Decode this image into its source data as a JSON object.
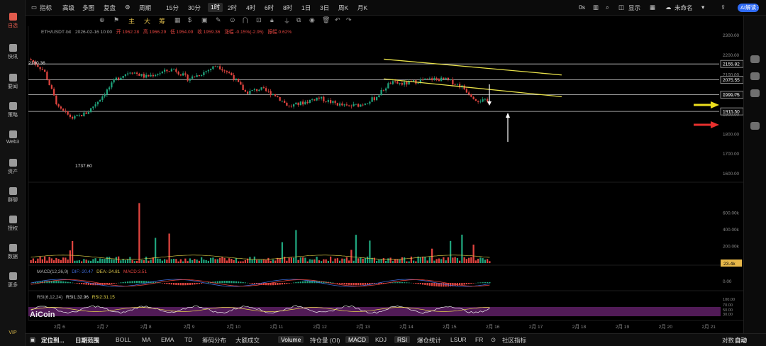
{
  "toolbar": {
    "indicators": "指标",
    "premium": "高级",
    "multi": "多图",
    "replay": "复盘",
    "period": "周期",
    "tf_15m": "15分",
    "tf_30m": "30分",
    "tf_1h": "1时",
    "tf_2h": "2时",
    "tf_4h": "4时",
    "tf_6h": "6时",
    "tf_8h": "8时",
    "tf_1d": "1日",
    "tf_3d": "3日",
    "tf_1w": "周K",
    "tf_1m": "月K",
    "seconds": "0s",
    "display": "显示",
    "unnamed": "未命名",
    "ai": "AI解读"
  },
  "drawbar": {
    "main": "主",
    "big": "大",
    "chips": "筹"
  },
  "rail": [
    {
      "label": "自选"
    },
    {
      "label": "快讯"
    },
    {
      "label": "要闻"
    },
    {
      "label": "策略"
    },
    {
      "label": "Web3"
    },
    {
      "label": "资产"
    },
    {
      "label": "群聊"
    },
    {
      "label": "授权"
    },
    {
      "label": "数据"
    },
    {
      "label": "更多"
    }
  ],
  "vip": "VIP",
  "chart_data": {
    "type": "candlestick",
    "symbol_line": {
      "symbol": "ETH/USDT·bit",
      "time": "2026-02-16 10:00",
      "open": "开 1962.28",
      "high": "高 1966.29",
      "low": "低 1954.09",
      "close": "收 1959.36",
      "change": "涨幅 -0.15%(-2.95)",
      "amplitude": "振幅 0.62%"
    },
    "price_axis_ticks": [
      "2300.00",
      "2200.00",
      "2100.00",
      "2000.00",
      "1900.00",
      "1800.00",
      "1700.00",
      "1600.00"
    ],
    "price_ylim": [
      1600,
      2300
    ],
    "volume_axis_ticks": [
      "600.00k",
      "400.00k",
      "200.00k"
    ],
    "volume_ylim": [
      0,
      800000
    ],
    "current_volume": "23.4k",
    "macd": {
      "label": "MACD(12,26,9)",
      "dif": "DIF:-20.47",
      "dea": "DEA:-24.81",
      "macd": "MACD:3.51",
      "ticks": [
        "0.00"
      ]
    },
    "rsi": {
      "label": "RSI(6,12,24)",
      "rsi1": "RSI1:32.96",
      "rsi2": "RSI2:31.15",
      "ticks": [
        "100.00",
        "70.00",
        "50.00",
        "30.00"
      ]
    },
    "x_dates": [
      "2月 6",
      "2月 7",
      "2月 8",
      "2月 9",
      "2月 10",
      "2月 11",
      "2月 12",
      "2月 13",
      "2月 14",
      "2月 15",
      "2月 16",
      "2月 17",
      "2月 18",
      "2月 19",
      "2月 20",
      "2月 21"
    ],
    "high_marker": "2180.36",
    "low_marker": "1737.60",
    "horizontal_levels": [
      {
        "value": 2155.82,
        "label": "2155.82"
      },
      {
        "value": 2075.55,
        "label": "2075.55"
      },
      {
        "value": 1999.75,
        "label": "1999.75"
      },
      {
        "value": 1915.5,
        "label": "1915.50"
      }
    ],
    "channel_lines": [
      {
        "from": [
          "2月 14",
          2180
        ],
        "to": [
          "2月 17",
          2100
        ],
        "color": "#e8e14a"
      },
      {
        "from": [
          "2月 14",
          2080
        ],
        "to": [
          "2月 17",
          1990
        ],
        "color": "#e8e14a"
      }
    ],
    "watermark": "AiCoin",
    "colors": {
      "up": "#1fa37c",
      "down": "#e0443f",
      "level": "#c9c9c9",
      "yellow": "#e8e14a",
      "red": "#e8302e",
      "rsi_band": "#5a1e60"
    },
    "close_path": [
      [
        "2月 6",
        2180
      ],
      [
        "2月 6",
        2120
      ],
      [
        "2月 6",
        1930
      ],
      [
        "2月 6",
        1880
      ],
      [
        "2月 7",
        1910
      ],
      [
        "2月 7",
        1990
      ],
      [
        "2月 7",
        2080
      ],
      [
        "2月 8",
        2120
      ],
      [
        "2月 8",
        2090
      ],
      [
        "2月 9",
        2110
      ],
      [
        "2月 9",
        2130
      ],
      [
        "2月 9",
        2080
      ],
      [
        "2月 10",
        2110
      ],
      [
        "2月 10",
        2150
      ],
      [
        "2月 10",
        2100
      ],
      [
        "2月 11",
        2010
      ],
      [
        "2月 11",
        2030
      ],
      [
        "2月 11",
        2000
      ],
      [
        "2月 12",
        1940
      ],
      [
        "2月 12",
        1960
      ],
      [
        "2月 12",
        1985
      ],
      [
        "2月 13",
        1960
      ],
      [
        "2月 13",
        1940
      ],
      [
        "2月 13",
        1950
      ],
      [
        "2月 14",
        1985
      ],
      [
        "2月 14",
        2060
      ],
      [
        "2月 14",
        2055
      ],
      [
        "2月 15",
        2070
      ],
      [
        "2月 15",
        2080
      ],
      [
        "2月 15",
        2075
      ],
      [
        "2月 16",
        2040
      ],
      [
        "2月 16",
        1975
      ],
      [
        "2月 16",
        1962
      ]
    ]
  },
  "bottombar": {
    "locate": "定位到...",
    "range": "日期范围",
    "boll": "BOLL",
    "ma": "MA",
    "ema": "EMA",
    "td": "TD",
    "chips": "筹码分布",
    "bigtrades": "大额成交",
    "volume": "Volume",
    "oi": "持仓量 (OI)",
    "macd": "MACD",
    "kdj": "KDJ",
    "rsi": "RSI",
    "liq": "爆仓统计",
    "lsur": "LSUR",
    "fr": "FR",
    "community": "社区指标",
    "log": "对数",
    "auto": "自动"
  }
}
